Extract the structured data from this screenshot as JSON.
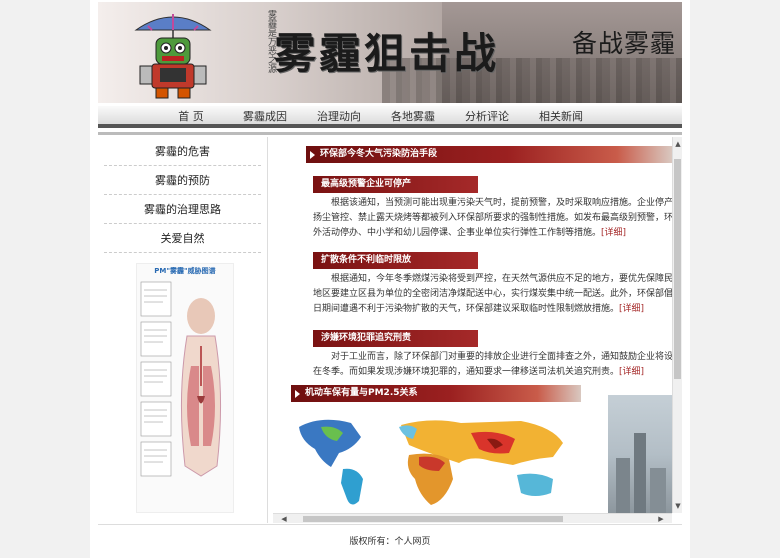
{
  "banner": {
    "title": "雾霾狙击战",
    "slogan": "备战雾霾",
    "scribble": "雾霾是万恶之源"
  },
  "nav": {
    "items": [
      "首 页",
      "雾霾成因",
      "治理动向",
      "各地雾霾",
      "分析评论",
      "相关新闻"
    ]
  },
  "sidebar": {
    "items": [
      "雾霾的危害",
      "雾霾的预防",
      "雾霾的治理思路",
      "关爱自然"
    ],
    "poster_title": "PM\"雾霾\"威胁图谱"
  },
  "main": {
    "section1": "环保部今冬大气污染防治手段",
    "article1": {
      "heading": "最高级预警企业可停产",
      "lines": [
        "根据该通知，当预测可能出现重污染天气时，提前预警，及时采取响应措施。企业停产、限产，",
        "扬尘管控、禁止露天烧烤等都被列入环保部所要求的强制性措施。如发布最高级别预警，环保部还要求",
        "外活动停办、中小学和幼儿园停课、企事业单位实行弹性工作制等措施。"
      ]
    },
    "article2": {
      "heading": "扩散条件不利临时限放",
      "lines": [
        "根据通知，今年冬季燃煤污染将受到严控，在天然气源供应不足的地方，要优先保障民生用气。",
        "地区要建立区县为单位的全密闭洁净煤配送中心，实行煤炭集中统一配送。此外，环保部倡导减少燃放",
        "日期间遭遇不利于污染物扩散的天气，环保部建议采取临时性限制燃放措施。"
      ]
    },
    "article3": {
      "heading": "涉嫌环境犯罪追究刑责",
      "lines": [
        "对于工业而言，除了环保部门对重要的排放企业进行全面排查之外，通知鼓励企业将设备检修计划放",
        "在冬季。而如果发现涉嫌环境犯罪的，通知要求一律移送司法机关追究刑责。"
      ]
    },
    "more_label": "[详细]",
    "section2": "机动车保有量与PM2.5关系"
  },
  "footer": {
    "text": "版权所有：个人网页"
  },
  "colors": {
    "accent": "#8b1a1a",
    "nav_border": "#555555"
  }
}
